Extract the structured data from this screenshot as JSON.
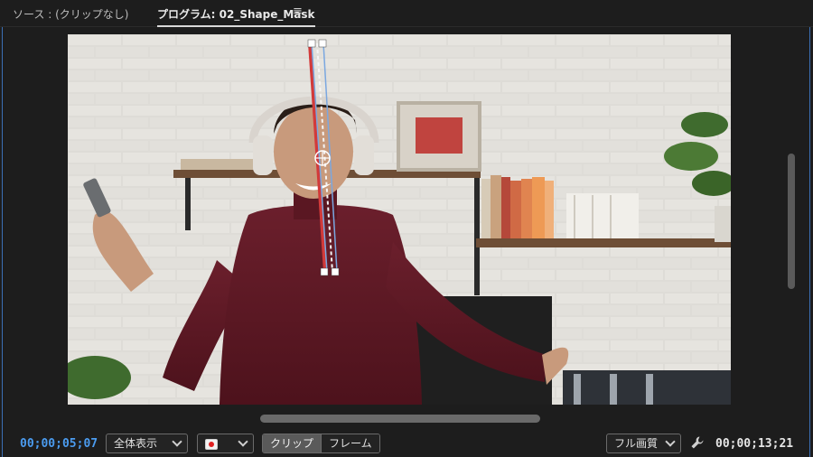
{
  "tabs": {
    "source": "ソース : (クリップなし)",
    "program": "プログラム: 02_Shape_Mask",
    "menu_glyph": "≡"
  },
  "controls": {
    "current_timecode": "00;00;05;07",
    "zoom_select": "全体表示",
    "clip_toggle": "クリップ",
    "frame_toggle": "フレーム",
    "quality_select": "フル画質",
    "duration_timecode": "00;00;13;21"
  },
  "icons": {
    "chevron": "chevron-down-icon",
    "color_mode": "record-icon",
    "settings": "wrench-icon"
  },
  "colors": {
    "timecode_blue": "#4b9cf0",
    "mask_red": "#d23a3a",
    "mask_handle": "#7aa7e0"
  }
}
